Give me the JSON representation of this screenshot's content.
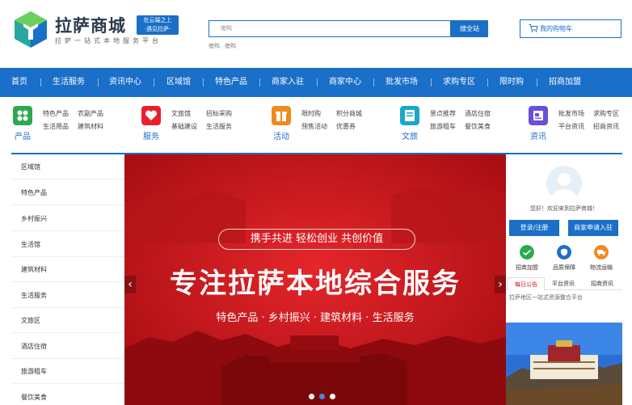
{
  "header": {
    "brand": "拉萨商城",
    "brand_tag_line1": "在云端之上",
    "brand_tag_line2": "·遇见拉萨·",
    "slogan": "拉萨一站式本地服务平台",
    "search": {
      "value": "雍鸭",
      "button": "搜全站"
    },
    "hot_words": [
      "雍鸭",
      "雍鸭"
    ],
    "cart_label": "我的购物车"
  },
  "nav": {
    "items": [
      "首页",
      "生活服务",
      "资讯中心",
      "区域馆",
      "特色产品",
      "商家入驻",
      "商家中心",
      "批发市场",
      "求购专区",
      "限时购",
      "招商加盟"
    ]
  },
  "categories": [
    {
      "name": "产品",
      "icon": "grid-icon",
      "color": "#2ca94f",
      "links": [
        "特色产品",
        "农副产品",
        "生活用品",
        "建筑材料"
      ]
    },
    {
      "name": "服务",
      "icon": "heart-icon",
      "color": "#e8202e",
      "links": [
        "文旅馆",
        "招标采购",
        "基础建设",
        "生活服务"
      ]
    },
    {
      "name": "活动",
      "icon": "gift-icon",
      "color": "#f08a1c",
      "links": [
        "限时购",
        "积分商城",
        "预售活动",
        "优惠券"
      ]
    },
    {
      "name": "文旅",
      "icon": "book-icon",
      "color": "#1aa7c9",
      "links": [
        "景点推荐",
        "酒店住宿",
        "旅游租车",
        "餐饮美食"
      ]
    },
    {
      "name": "资讯",
      "icon": "news-icon",
      "color": "#6b4fd8",
      "links": [
        "批发市场",
        "求购专区",
        "平台资讯",
        "招商资讯"
      ]
    }
  ],
  "sidebar": {
    "items": [
      "区域馆",
      "特色产品",
      "乡村振兴",
      "生活馆",
      "建筑材料",
      "生活服务",
      "文旅区",
      "酒店住宿",
      "旅游租车",
      "餐饮美食"
    ]
  },
  "banner": {
    "slogan": "携手共进  轻松创业  共创价值",
    "headline": "专注拉萨本地综合服务",
    "subline": "特色产品 · 乡村振兴 · 建筑材料 · 生活服务",
    "prev_arrow": "‹",
    "next_arrow": "›",
    "slide_count": 3,
    "active_slide": 2
  },
  "user_panel": {
    "welcome": "您好！欢迎来到拉萨商城！",
    "login_button": "登录/注册",
    "merchant_button": "商家申请入驻",
    "services": [
      {
        "label": "招商加盟",
        "icon": "handshake-icon",
        "color": "#2ca94f"
      },
      {
        "label": "品质保障",
        "icon": "shield-icon",
        "color": "#1a6fc9"
      },
      {
        "label": "物流运输",
        "icon": "truck-icon",
        "color": "#f08a1c"
      }
    ],
    "tabs": [
      "每日公告",
      "平台资讯",
      "招商资讯"
    ],
    "active_tab": "每日公告",
    "notice": "拉萨地区一站式资源整合平台"
  },
  "colors": {
    "primary": "#1a6fc9",
    "banner_red": "#c9161b",
    "highlight": "#c9161b"
  }
}
